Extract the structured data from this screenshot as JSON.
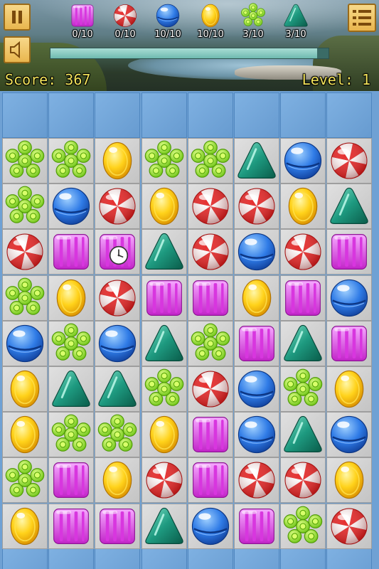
{
  "hud": {
    "score_label": "Score:",
    "score_value": "367",
    "level_label": "Level:",
    "level_value": "1",
    "progress": 0.96,
    "goals": [
      {
        "candy": "pink-striped",
        "count": "0/10"
      },
      {
        "candy": "red-swirl",
        "count": "0/10"
      },
      {
        "candy": "blue-ball",
        "count": "10/10"
      },
      {
        "candy": "yellow-oval",
        "count": "10/10"
      },
      {
        "candy": "green-flower",
        "count": "3/10"
      },
      {
        "candy": "teal-triangle",
        "count": "3/10"
      }
    ],
    "icons": {
      "pause": "pause-icon",
      "sound": "speaker-icon",
      "menu": "list-menu-icon"
    }
  },
  "board": {
    "columns": 8,
    "grid": [
      [
        "G",
        "G",
        "Y",
        "G",
        "G",
        "T",
        "B",
        "R"
      ],
      [
        "G",
        "B",
        "R",
        "Y",
        "R",
        "R",
        "Y",
        "T"
      ],
      [
        "R",
        "P",
        "P",
        "T",
        "R",
        "B",
        "R",
        "P"
      ],
      [
        "G",
        "Y",
        "R",
        "P",
        "P",
        "Y",
        "P",
        "B"
      ],
      [
        "B",
        "G",
        "B",
        "T",
        "G",
        "P",
        "T",
        "P"
      ],
      [
        "Y",
        "T",
        "T",
        "G",
        "R",
        "B",
        "G",
        "Y"
      ],
      [
        "Y",
        "G",
        "G",
        "Y",
        "P",
        "B",
        "T",
        "B"
      ],
      [
        "G",
        "P",
        "Y",
        "R",
        "P",
        "R",
        "R",
        "Y"
      ],
      [
        "Y",
        "P",
        "P",
        "T",
        "B",
        "P",
        "G",
        "R"
      ]
    ],
    "legend": {
      "R": "red-swirl",
      "B": "blue-ball",
      "Y": "yellow-oval",
      "G": "green-flower",
      "T": "teal-triangle",
      "P": "pink-striped"
    },
    "special": {
      "row": 2,
      "col": 2,
      "icon": "clock-icon"
    }
  }
}
